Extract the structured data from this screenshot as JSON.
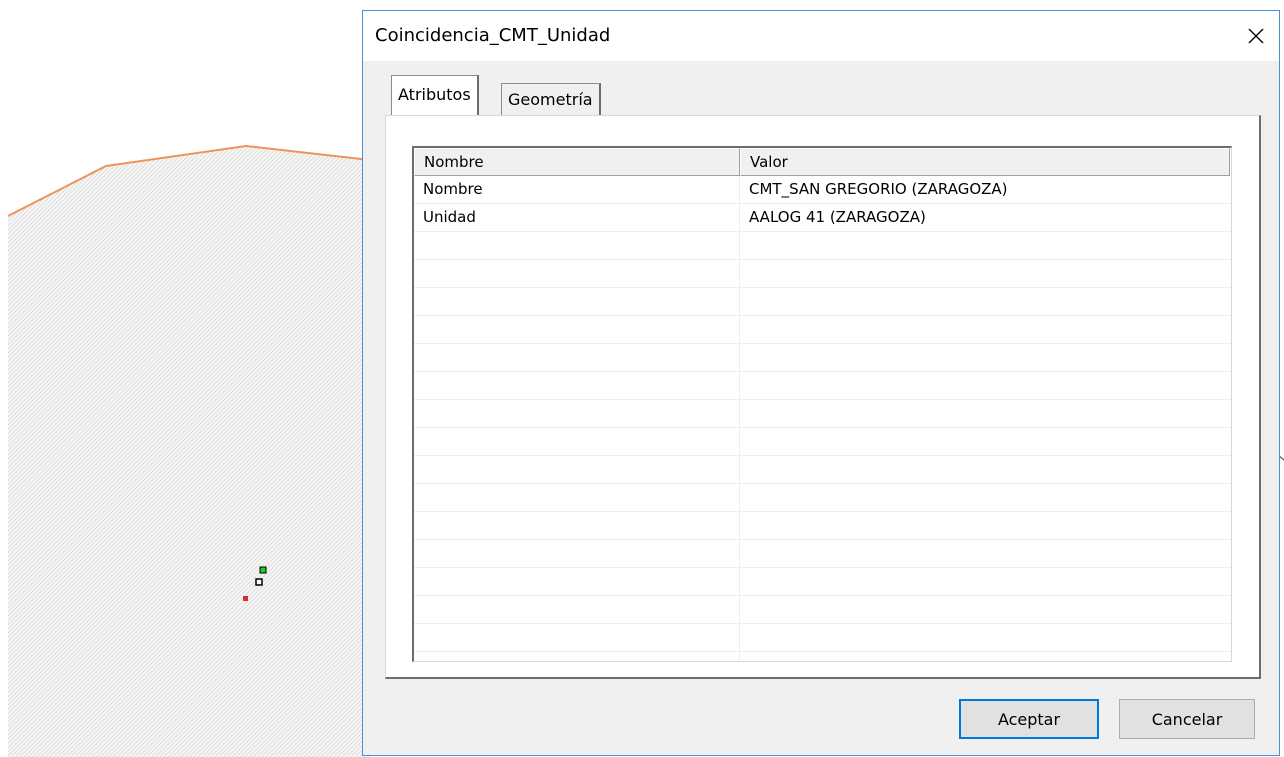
{
  "dialog": {
    "title": "Coincidencia_CMT_Unidad",
    "close_icon": "close-icon"
  },
  "tabs": [
    {
      "label": "Atributos",
      "active": true
    },
    {
      "label": "Geometría",
      "active": false
    }
  ],
  "table": {
    "columns": [
      "Nombre",
      "Valor"
    ],
    "rows": [
      {
        "nombre": "Nombre",
        "valor": "CMT_SAN GREGORIO (ZARAGOZA)"
      },
      {
        "nombre": "Unidad",
        "valor": "AALOG 41 (ZARAGOZA)"
      }
    ]
  },
  "buttons": {
    "ok_label": "Aceptar",
    "cancel_label": "Cancelar"
  },
  "colors": {
    "map_boundary": "#f0925a",
    "dialog_border": "#4a90d9",
    "default_button_border": "#0078d7"
  }
}
